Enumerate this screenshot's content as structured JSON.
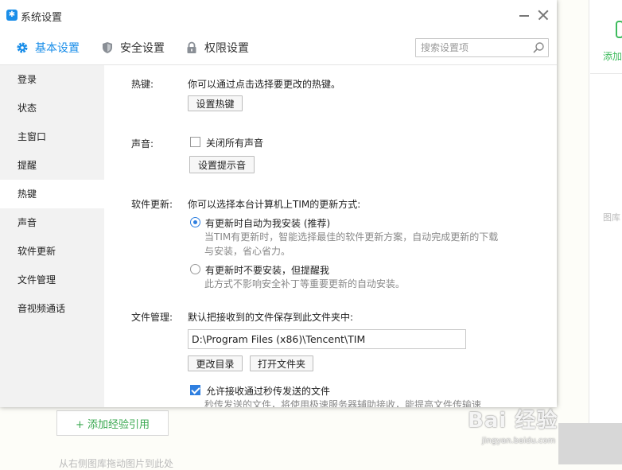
{
  "background": {
    "add_label": "添加",
    "pic_label": "图库",
    "add_ref_button": "+ 添加经验引用",
    "hint": "从右侧图库拖动图片到此处",
    "watermark_brand": "Bai 经验",
    "watermark_url": "jingyan.baidu.com"
  },
  "dialog": {
    "title": "系统设置",
    "logo_glyph": "✱",
    "tabs": [
      {
        "label": "基本设置",
        "icon": "gear-icon",
        "active": true
      },
      {
        "label": "安全设置",
        "icon": "shield-icon",
        "active": false
      },
      {
        "label": "权限设置",
        "icon": "lock-icon",
        "active": false
      }
    ],
    "search_placeholder": "搜索设置项",
    "accent_color": "#1a8ee9",
    "sidebar": [
      {
        "label": "登录"
      },
      {
        "label": "状态"
      },
      {
        "label": "主窗口"
      },
      {
        "label": "提醒"
      },
      {
        "label": "热键",
        "active": true
      },
      {
        "label": "声音"
      },
      {
        "label": "软件更新"
      },
      {
        "label": "文件管理"
      },
      {
        "label": "音视频通话"
      }
    ],
    "hotkey": {
      "label": "热键:",
      "text": "你可以通过点击选择要更改的热键。",
      "button": "设置热键"
    },
    "sound": {
      "label": "声音:",
      "mute_all": "关闭所有声音",
      "mute_checked": false,
      "button": "设置提示音"
    },
    "update": {
      "label": "软件更新:",
      "text": "你可以选择本台计算机上TIM的更新方式:",
      "auto_label": "有更新时自动为我安装 (推荐)",
      "auto_desc": "当TIM有更新时，智能选择最佳的软件更新方案，自动完成更新的下载与安装，省心省力。",
      "auto_checked": true,
      "notify_label": "有更新时不要安装，但提醒我",
      "notify_desc": "此方式不影响安全补丁等重要更新的自动安装。",
      "notify_checked": false
    },
    "files": {
      "label": "文件管理:",
      "text": "默认把接收到的文件保存到此文件夹中:",
      "path": "D:\\Program Files (x86)\\Tencent\\TIM",
      "change_button": "更改目录",
      "open_button": "打开文件夹",
      "instant_label": "允许接收通过秒传发送的文件",
      "instant_checked": true,
      "instant_desc": "秒传发送的文件，将使用极速服务器辅助接收，能提高文件传输速"
    }
  }
}
